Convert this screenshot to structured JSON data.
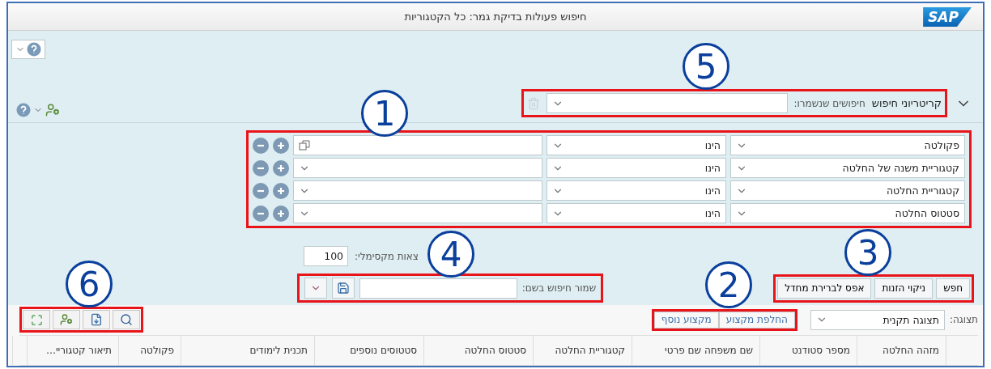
{
  "window": {
    "title": "חיפוש פעולות בדיקת גמר: כל הקטגוריות",
    "logo": "SAP"
  },
  "criteria_header": {
    "title": "קריטריוני חיפוש",
    "expanded": true,
    "saved_searches_label": "חיפושים שנשמרו:"
  },
  "criteria_rows": [
    {
      "field": "פקולטה",
      "operator": "הינו",
      "kind": "multi"
    },
    {
      "field": "קטגוריית משנה של החלטה",
      "operator": "הינו",
      "kind": "dropdown"
    },
    {
      "field": "קטגוריית החלטה",
      "operator": "הינו",
      "kind": "dropdown"
    },
    {
      "field": "סטטוס החלטה",
      "operator": "הינו",
      "kind": "dropdown"
    }
  ],
  "max_results": {
    "label": "צאות מקסימלי:",
    "value": "100"
  },
  "save_search": {
    "label": "שמור חיפוש בשם:"
  },
  "buttons": [
    "חפש",
    "ניקוי הזנות",
    "אפס לברירת מחדל"
  ],
  "results_toolbar": {
    "view_label": "תצוגה:",
    "view_value": "תצוגה תקנית",
    "buttons": [
      "החלפת מקצוע",
      "מקצוע נוסף"
    ]
  },
  "table": {
    "columns": [
      "",
      "מזהה החלטה",
      "מספר סטודנט",
      "שם משפחה שם פרטי",
      "קטגוריית החלטה",
      "סטטוס החלטה",
      "סטטוסים נוספים",
      "תכנית לימודים",
      "פקולטה",
      "תיאור קטגוריי…",
      ""
    ]
  },
  "annotations": [
    {
      "number": "5"
    },
    {
      "number": "1"
    },
    {
      "number": "4"
    },
    {
      "number": "3"
    },
    {
      "number": "2"
    },
    {
      "number": "6"
    }
  ]
}
